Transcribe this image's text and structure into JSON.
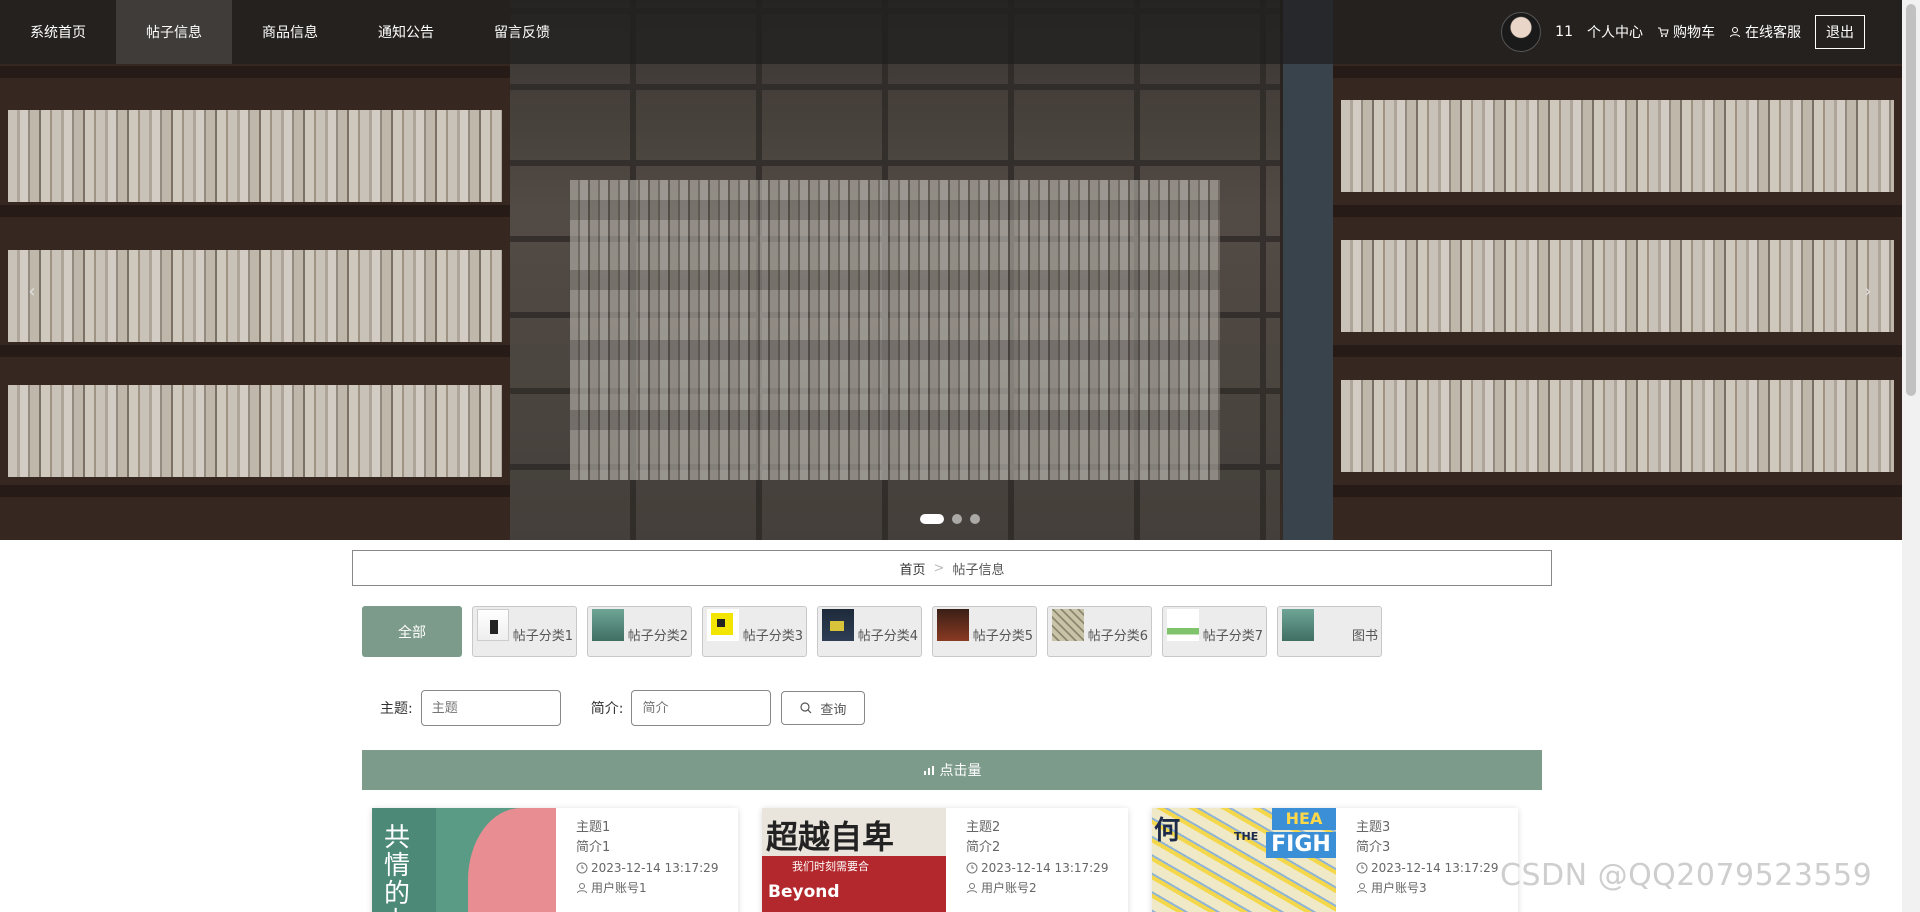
{
  "nav": {
    "items": [
      {
        "label": "系统首页"
      },
      {
        "label": "帖子信息"
      },
      {
        "label": "商品信息"
      },
      {
        "label": "通知公告"
      },
      {
        "label": "留言反馈"
      }
    ],
    "username": "11",
    "personal_center": "个人中心",
    "cart": "购物车",
    "service": "在线客服",
    "logout": "退出"
  },
  "carousel": {
    "slide_count": 3,
    "active_index": 0
  },
  "breadcrumb": {
    "home": "首页",
    "separator": ">",
    "current": "帖子信息"
  },
  "categories": {
    "all_label": "全部",
    "items": [
      {
        "label": "帖子分类1"
      },
      {
        "label": "帖子分类2"
      },
      {
        "label": "帖子分类3"
      },
      {
        "label": "帖子分类4"
      },
      {
        "label": "帖子分类5"
      },
      {
        "label": "帖子分类6"
      },
      {
        "label": "帖子分类7"
      },
      {
        "label": "图书"
      }
    ]
  },
  "search": {
    "topic_label": "主题:",
    "topic_placeholder": "主题",
    "intro_label": "简介:",
    "intro_placeholder": "简介",
    "button": "查询"
  },
  "sort": {
    "label": "点击量"
  },
  "posts": [
    {
      "title": "主题1",
      "intro": "简介1",
      "time": "2023-12-14 13:17:29",
      "user": "用户账号1",
      "cover_text": "共情的力"
    },
    {
      "title": "主题2",
      "intro": "简介2",
      "time": "2023-12-14 13:17:29",
      "user": "用户账号2",
      "cover_text": "超越自卑",
      "cover_sub": "我们时刻需要合",
      "cover_en": "Beyond"
    },
    {
      "title": "主题3",
      "intro": "简介3",
      "time": "2023-12-14 13:17:29",
      "user": "用户账号3",
      "cover_text": "何",
      "cover_en1": "HEA",
      "cover_en2": "THE",
      "cover_en3": "FIGH"
    }
  ],
  "watermark": "CSDN @QQ2079523559",
  "colors": {
    "accent": "#7d9b8b",
    "nav_bg": "rgba(30,30,30,0.72)"
  }
}
